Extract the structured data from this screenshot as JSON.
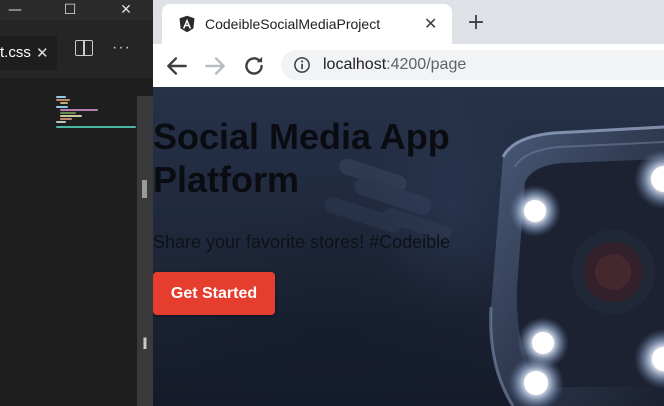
{
  "vscode": {
    "window_controls": {
      "minimize": "—",
      "maximize": "☐",
      "close": "✕"
    },
    "tab": {
      "label": "t.css",
      "close": "✕"
    },
    "more_actions": "···",
    "cursor_glyph": "I"
  },
  "browser": {
    "tab": {
      "title": "CodeibleSocialMediaProject",
      "favicon": "angular-logo",
      "close": "✕"
    },
    "new_tab": "+",
    "url": {
      "host": "localhost",
      "rest": ":4200/page"
    },
    "icons": [
      "back-arrow-icon",
      "forward-arrow-icon",
      "reload-icon",
      "info-icon"
    ]
  },
  "page": {
    "hero": {
      "title": "Social Media App Platform",
      "subtitle": "Share your favorite stores! #Codeible",
      "cta": "Get Started"
    },
    "colors": {
      "cta": "#e53e2e",
      "background": "#1e2638"
    }
  }
}
